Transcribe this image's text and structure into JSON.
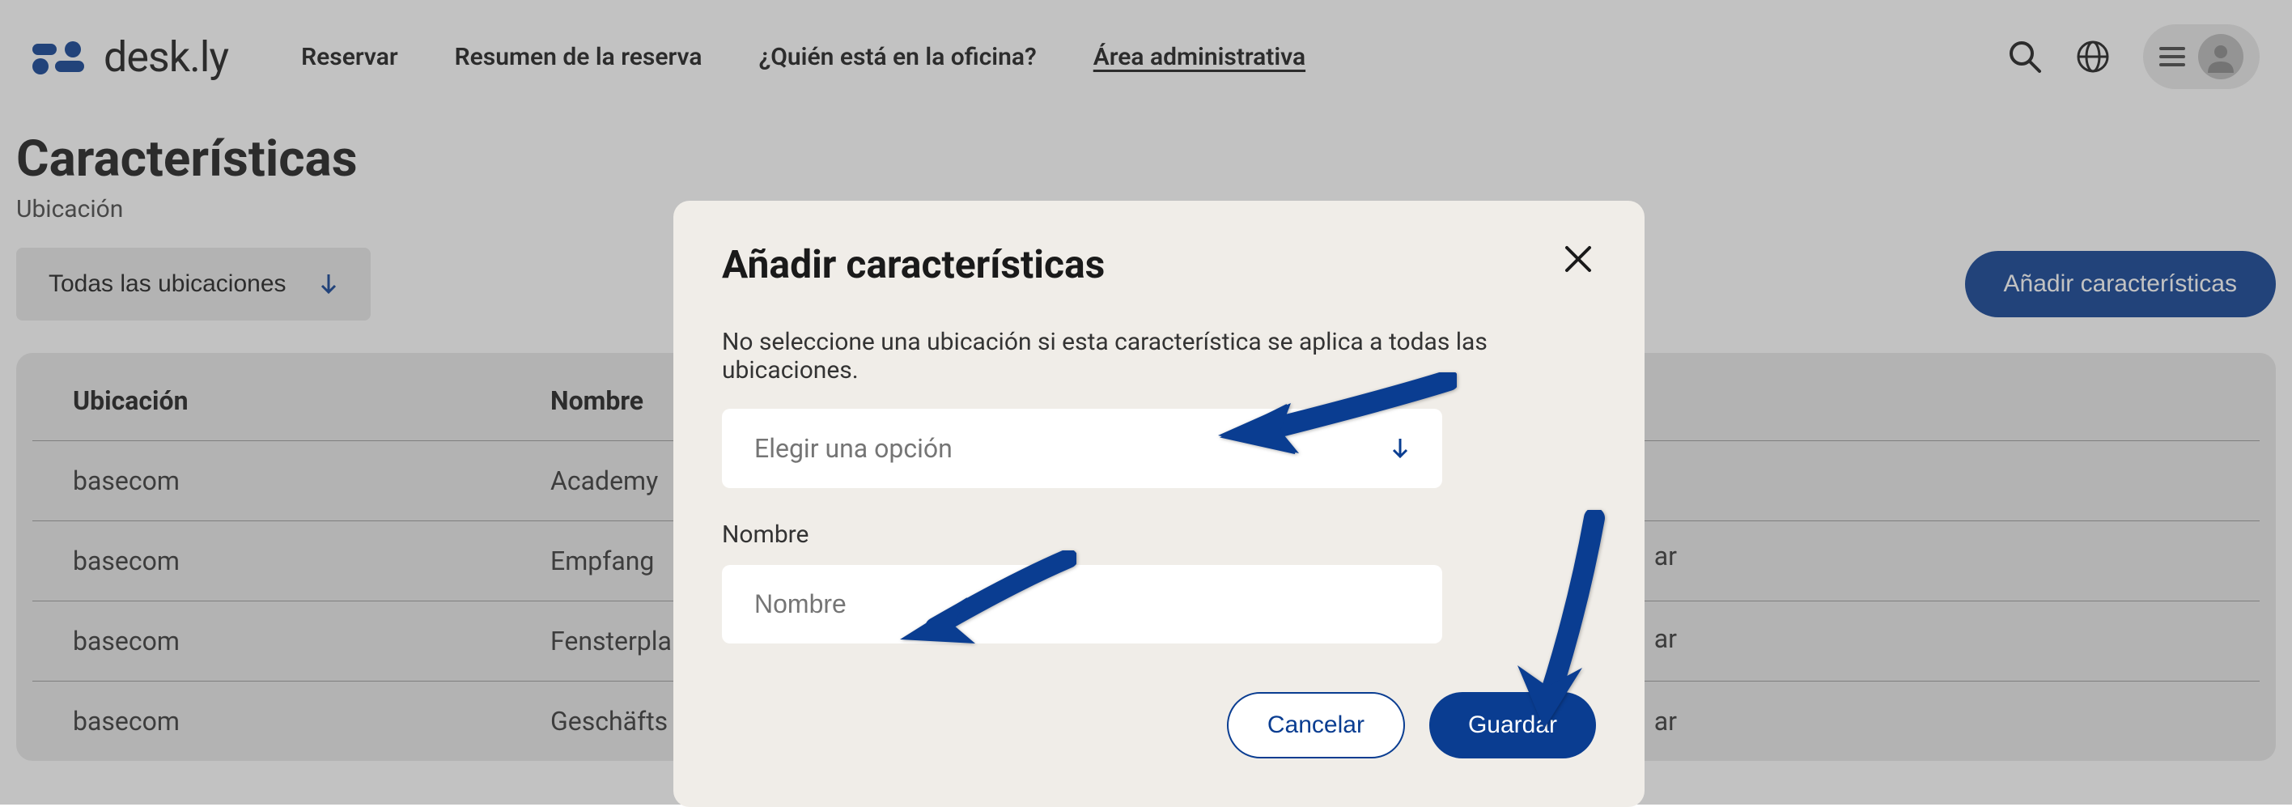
{
  "header": {
    "logo_text": "desk.ly",
    "nav": {
      "reservar": "Reservar",
      "resumen": "Resumen de la reserva",
      "quien": "¿Quién está en la oficina?",
      "admin": "Área administrativa"
    }
  },
  "page": {
    "title": "Características",
    "subtitle": "Ubicación",
    "filter_label": "Todas las ubicaciones",
    "add_button": "Añadir características"
  },
  "table": {
    "headers": {
      "ubicacion": "Ubicación",
      "nombre": "Nombre"
    },
    "rows": [
      {
        "ubicacion": "basecom",
        "nombre": "Academy"
      },
      {
        "ubicacion": "basecom",
        "nombre": "Empfang"
      },
      {
        "ubicacion": "basecom",
        "nombre": "Fensterpla"
      },
      {
        "ubicacion": "basecom",
        "nombre": "Geschäfts"
      }
    ]
  },
  "edge_fragments": {
    "r1": "ar",
    "r2": "ar",
    "r3": "ar"
  },
  "modal": {
    "title": "Añadir características",
    "hint": "No seleccione una ubicación si esta característica se aplica a todas las ubicaciones.",
    "select_placeholder": "Elegir una opción",
    "name_label": "Nombre",
    "name_placeholder": "Nombre",
    "cancel": "Cancelar",
    "save": "Guardar"
  }
}
